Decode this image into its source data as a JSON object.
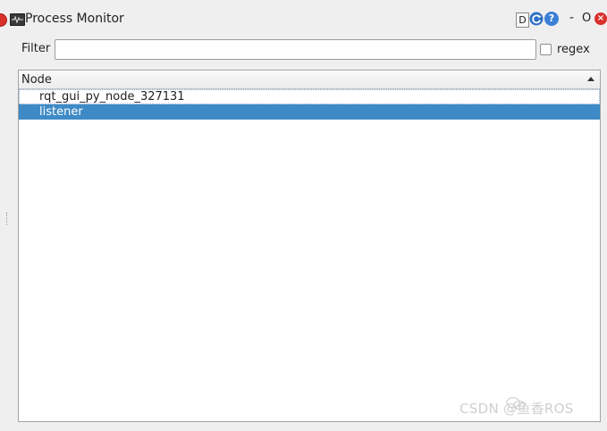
{
  "window": {
    "title": "Process Monitor",
    "d_button_label": "D",
    "help_label": "?",
    "minimize_label": "-",
    "float_label": "O",
    "close_label": "×",
    "icons": {
      "app": "process-monitor-icon",
      "refresh": "refresh-icon",
      "help": "help-icon",
      "close": "close-icon"
    }
  },
  "filter": {
    "label": "Filter",
    "value": "",
    "placeholder": "",
    "regex_label": "regex",
    "regex_checked": false
  },
  "tree": {
    "column_header": "Node",
    "sort_order": "ascending",
    "rows": [
      {
        "label": "rqt_gui_py_node_327131",
        "selected": false,
        "focused": true
      },
      {
        "label": "listener",
        "selected": true,
        "focused": false
      }
    ],
    "selection_color": "#3d8ac6"
  },
  "watermark": {
    "text": "CSDN @鱼香ROS"
  }
}
